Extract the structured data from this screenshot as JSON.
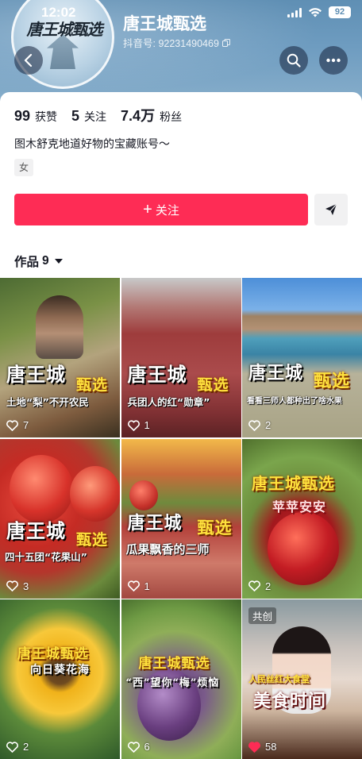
{
  "status_bar": {
    "time": "12:02",
    "battery": "92"
  },
  "profile": {
    "avatar_text": "唐王城甄选",
    "name": "唐王城甄选",
    "id_label": "抖音号: 92231490469",
    "stats": [
      {
        "value": "99",
        "label": "获赞"
      },
      {
        "value": "5",
        "label": "关注"
      },
      {
        "value": "7.4万",
        "label": "粉丝"
      }
    ],
    "bio": "图木舒克地道好物的宝藏账号～",
    "gender_tag": "女"
  },
  "actions": {
    "follow_label": "关注",
    "follow_prefix": "+"
  },
  "works": {
    "label": "作品",
    "count": "9",
    "items": [
      {
        "title_a": "唐王城",
        "title_b": "甄选",
        "subtitle": "土地“梨”不开农民",
        "likes": "7"
      },
      {
        "title_a": "唐王城",
        "title_b": "甄选",
        "subtitle": "兵团人的红“勋章”",
        "likes": "1"
      },
      {
        "title_a": "唐王城",
        "title_b": "甄选",
        "subtitle": "看看三师人都种出了啥水果",
        "likes": "2"
      },
      {
        "title_a": "唐王城",
        "title_b": "甄选",
        "subtitle": "四十五团“花果山”",
        "likes": "3"
      },
      {
        "title_a": "唐王城",
        "title_b": "甄选",
        "subtitle": "瓜果飘香的三师",
        "likes": "1"
      },
      {
        "title_a": "唐王城甄选",
        "title_b": "苹苹安安",
        "subtitle": "",
        "likes": "2"
      },
      {
        "title_a": "唐王城甄选",
        "title_b": "向日葵花海",
        "subtitle": "",
        "likes": "2"
      },
      {
        "title_a": "唐王城甄选",
        "title_b": "“西”望你“梅”烦恼",
        "subtitle": "",
        "likes": "6"
      },
      {
        "badge": "共创",
        "title_a": "人民丝红大食堂",
        "title_b": "美食时间",
        "subtitle": "",
        "likes": "58",
        "liked": true
      }
    ]
  },
  "colors": {
    "accent": "#fe2c55",
    "header_bg": "#6e9cc0",
    "liked": "#fe2c55"
  }
}
